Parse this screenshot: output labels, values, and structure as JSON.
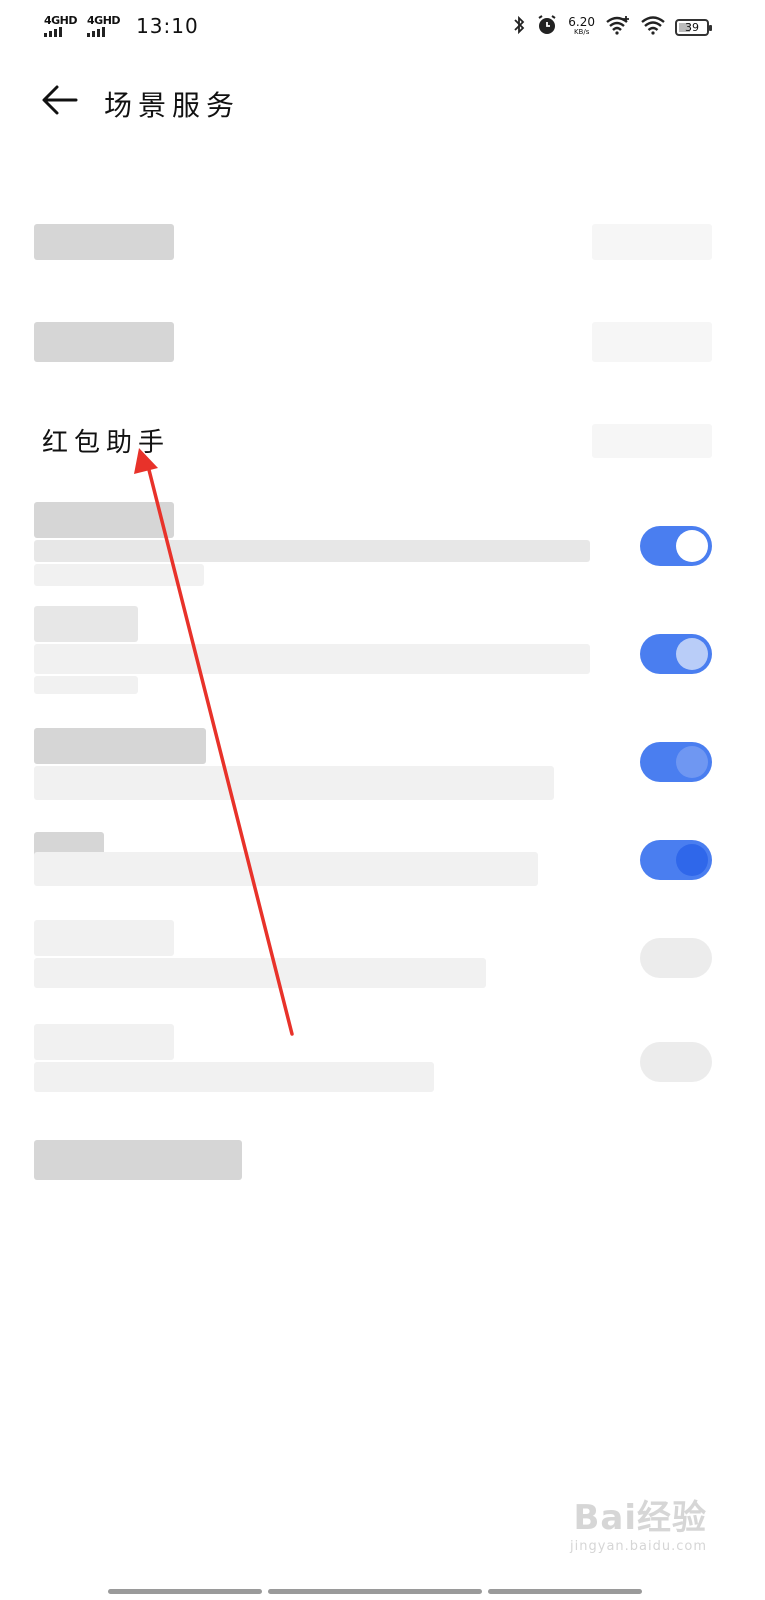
{
  "status_bar": {
    "sim1": "4GHD",
    "sim2": "4GHD",
    "time": "13:10",
    "net_speed": "6.20",
    "net_speed_unit": "KB/s",
    "battery": "39"
  },
  "header": {
    "title": "场景服务"
  },
  "list": {
    "red_packet_title": "红包助手"
  },
  "watermark": {
    "brand": "Bai经验",
    "site": "jingyan.baidu.com"
  },
  "colors": {
    "toggle_on": "#4a7ef0",
    "annotation_arrow": "#e8322a"
  }
}
